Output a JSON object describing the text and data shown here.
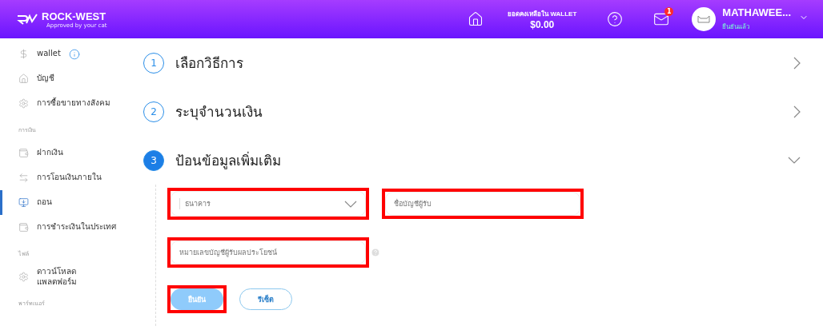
{
  "header": {
    "brand": "ROCK-WEST",
    "tagline": "Approved by your cat",
    "balance_label": "ยอดคงเหลือใน WALLET",
    "balance": "$0.00",
    "messages_badge": "1",
    "user_name": "MATHAWEE...",
    "user_status": "ยืนยันแล้ว"
  },
  "sidebar": {
    "items": [
      {
        "kind": "item",
        "label": "wallet",
        "selected": false,
        "info": true
      },
      {
        "kind": "item",
        "label": "บัญชี",
        "selected": false,
        "info": false
      },
      {
        "kind": "item",
        "label": "การซื้อขายทางสังคม",
        "selected": false,
        "info": false
      },
      {
        "kind": "section",
        "label": "การเงิน"
      },
      {
        "kind": "item",
        "label": "ฝากเงิน",
        "selected": false,
        "info": false
      },
      {
        "kind": "item",
        "label": "การโอนเงินภายใน",
        "selected": false,
        "info": false
      },
      {
        "kind": "item",
        "label": "ถอน",
        "selected": true,
        "info": false
      },
      {
        "kind": "item",
        "label": "การชำระเงินในประเทศ",
        "selected": false,
        "info": false
      },
      {
        "kind": "section",
        "label": "ไฟล์"
      },
      {
        "kind": "item",
        "label": "ดาวน์โหลด\nแพลตฟอร์ม",
        "selected": false,
        "info": false
      },
      {
        "kind": "section",
        "label": "พาร์ทเนอร์"
      }
    ]
  },
  "steps": [
    {
      "number": "1",
      "title": "เลือกวิธีการ",
      "expanded": false
    },
    {
      "number": "2",
      "title": "ระบุจำนวนเงิน",
      "expanded": false
    },
    {
      "number": "3",
      "title": "ป้อนข้อมูลเพิ่มเติม",
      "expanded": true
    }
  ],
  "form": {
    "fields": [
      {
        "kind": "select",
        "placeholder": "ธนาคาร",
        "highlighted": true,
        "help": false
      },
      {
        "kind": "text",
        "placeholder": "ชื่อบัญชีผู้รับ",
        "highlighted": true,
        "help": false
      },
      {
        "kind": "text",
        "placeholder": "หมายเลขบัญชีผู้รับผลประโยชน์",
        "highlighted": true,
        "help": true
      }
    ],
    "buttons": [
      {
        "kind": "primary",
        "label": "ยืนยัน",
        "highlighted": true
      },
      {
        "kind": "secondary",
        "label": "รีเซ็ต",
        "highlighted": false
      }
    ]
  }
}
